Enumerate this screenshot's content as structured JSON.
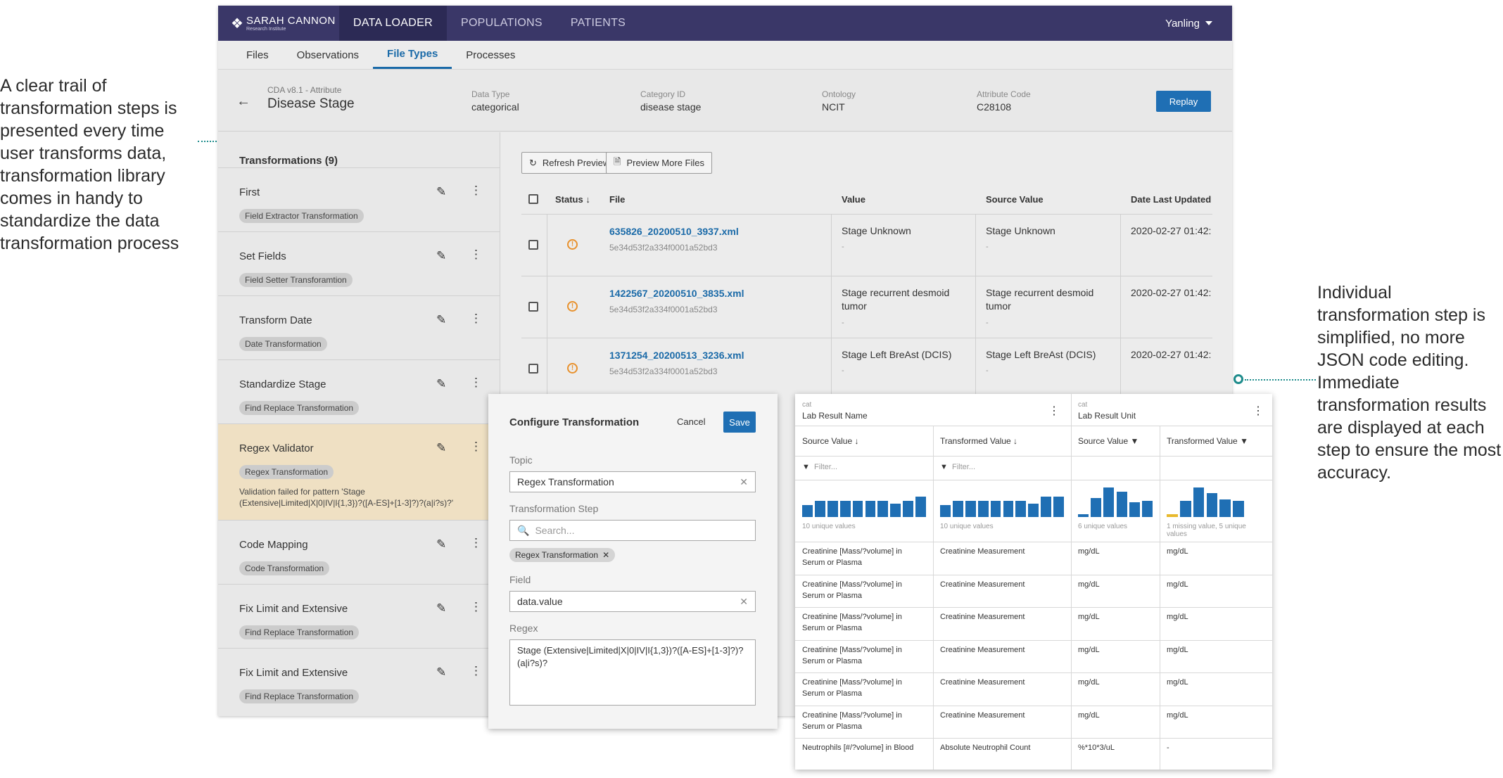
{
  "annotations": {
    "left": "A clear trail of transformation steps is presented every time user transforms data, transformation library comes in handy to standardize the data transformation process",
    "right": "Individual transformation step is simplified, no more JSON code editing. Immediate transformation results are displayed at each step to ensure the most accuracy."
  },
  "brand": {
    "name": "SARAH CANNON",
    "sub": "Research Institute"
  },
  "nav": {
    "items": [
      "DATA LOADER",
      "POPULATIONS",
      "PATIENTS"
    ],
    "user": "Yanling"
  },
  "subtabs": [
    "Files",
    "Observations",
    "File Types",
    "Processes"
  ],
  "header": {
    "crumb": "CDA v8.1 - Attribute",
    "title": "Disease Stage",
    "data_type_label": "Data Type",
    "data_type": "categorical",
    "category_label": "Category ID",
    "category": "disease stage",
    "ontology_label": "Ontology",
    "ontology": "NCIT",
    "code_label": "Attribute Code",
    "code": "C28108",
    "replay": "Replay"
  },
  "transformations": {
    "title": "Transformations (9)",
    "items": [
      {
        "name": "First",
        "type": "Field Extractor Transformation"
      },
      {
        "name": "Set Fields",
        "type": "Field Setter Transforamtion"
      },
      {
        "name": "Transform Date",
        "type": "Date Transformation"
      },
      {
        "name": "Standardize Stage",
        "type": "Find Replace Transformation"
      },
      {
        "name": "Regex Validator",
        "type": "Regex Transformation",
        "error": "Validation failed for pattern 'Stage (Extensive|Limited|X|0|IV|I{1,3})?([A-ES]+[1-3]?)?(a|i?s)?'"
      },
      {
        "name": "Code Mapping",
        "type": "Code Transformation"
      },
      {
        "name": "Fix Limit and Extensive",
        "type": "Find Replace Transformation"
      },
      {
        "name": "Fix Limit and Extensive",
        "type": "Find Replace Transformation"
      }
    ]
  },
  "preview": {
    "refresh": "Refresh Preview",
    "more": "Preview More Files",
    "columns": {
      "status": "Status",
      "file": "File",
      "value": "Value",
      "source": "Source Value",
      "date": "Date Last Updated"
    },
    "rows": [
      {
        "file": "635826_20200510_3937.xml",
        "id": "5e34d53f2a334f0001a52bd3",
        "value": "Stage Unknown",
        "source": "Stage Unknown",
        "date": "2020-02-27 01:42:"
      },
      {
        "file": "1422567_20200510_3835.xml",
        "id": "5e34d53f2a334f0001a52bd3",
        "value": "Stage recurrent desmoid tumor",
        "source": "Stage recurrent desmoid tumor",
        "date": "2020-02-27 01:42:"
      },
      {
        "file": "1371254_20200513_3236.xml",
        "id": "5e34d53f2a334f0001a52bd3",
        "value": "Stage Left BreAst (DCIS)",
        "source": "Stage Left BreAst (DCIS)",
        "date": "2020-02-27 01:42:"
      }
    ],
    "dash": "-"
  },
  "configure": {
    "title": "Configure Transformation",
    "cancel": "Cancel",
    "save": "Save",
    "topic_label": "Topic",
    "topic": "Regex Transformation",
    "step_label": "Transformation Step",
    "search_placeholder": "Search...",
    "step_chip": "Regex Transformation",
    "field_label": "Field",
    "field": "data.value",
    "regex_label": "Regex",
    "regex": "Stage (Extensive|Limited|X|0|IV|I{1,3})?([A-ES]+[1-3]?)?(a|i?s)?"
  },
  "lab": {
    "group1": {
      "cat": "cat",
      "name": "Lab Result Name"
    },
    "group2": {
      "cat": "cat",
      "name": "Lab Result Unit"
    },
    "cols": [
      "Source Value",
      "Transformed Value",
      "Source Value",
      "Transformed Value"
    ],
    "filter_placeholder": "Filter...",
    "hist_labels": [
      "10 unique values",
      "10 unique values",
      "6 unique values",
      "1 missing value, 5 unique values"
    ],
    "histograms": [
      [
        0.4,
        0.55,
        0.55,
        0.55,
        0.55,
        0.55,
        0.55,
        0.45,
        0.55,
        0.7
      ],
      [
        0.4,
        0.55,
        0.55,
        0.55,
        0.55,
        0.55,
        0.55,
        0.45,
        0.7,
        0.7
      ],
      [
        0.1,
        0.65,
        1.0,
        0.85,
        0.5,
        0.55
      ],
      [
        0.1,
        0.55,
        1.0,
        0.8,
        0.6,
        0.55
      ]
    ],
    "rows": [
      [
        "Creatinine [Mass/?volume] in Serum or Plasma",
        "Creatinine Measurement",
        "mg/dL",
        "mg/dL"
      ],
      [
        "Creatinine [Mass/?volume] in Serum or Plasma",
        "Creatinine Measurement",
        "mg/dL",
        "mg/dL"
      ],
      [
        "Creatinine [Mass/?volume] in Serum or Plasma",
        "Creatinine Measurement",
        "mg/dL",
        "mg/dL"
      ],
      [
        "Creatinine [Mass/?volume] in Serum or Plasma",
        "Creatinine Measurement",
        "mg/dL",
        "mg/dL"
      ],
      [
        "Creatinine [Mass/?volume] in Serum or Plasma",
        "Creatinine Measurement",
        "mg/dL",
        "mg/dL"
      ],
      [
        "Creatinine [Mass/?volume] in Serum or Plasma",
        "Creatinine Measurement",
        "mg/dL",
        "mg/dL"
      ],
      [
        "Neutrophils [#/?volume] in Blood",
        "Absolute Neutrophil Count",
        "%*10*3/uL",
        "-"
      ]
    ]
  },
  "colors": {
    "accent": "#1f6fb4",
    "nav": "#3a3768",
    "highlight": "#efe0c3",
    "warning": "#e8912d",
    "annotation_line": "#1e8c8c"
  }
}
